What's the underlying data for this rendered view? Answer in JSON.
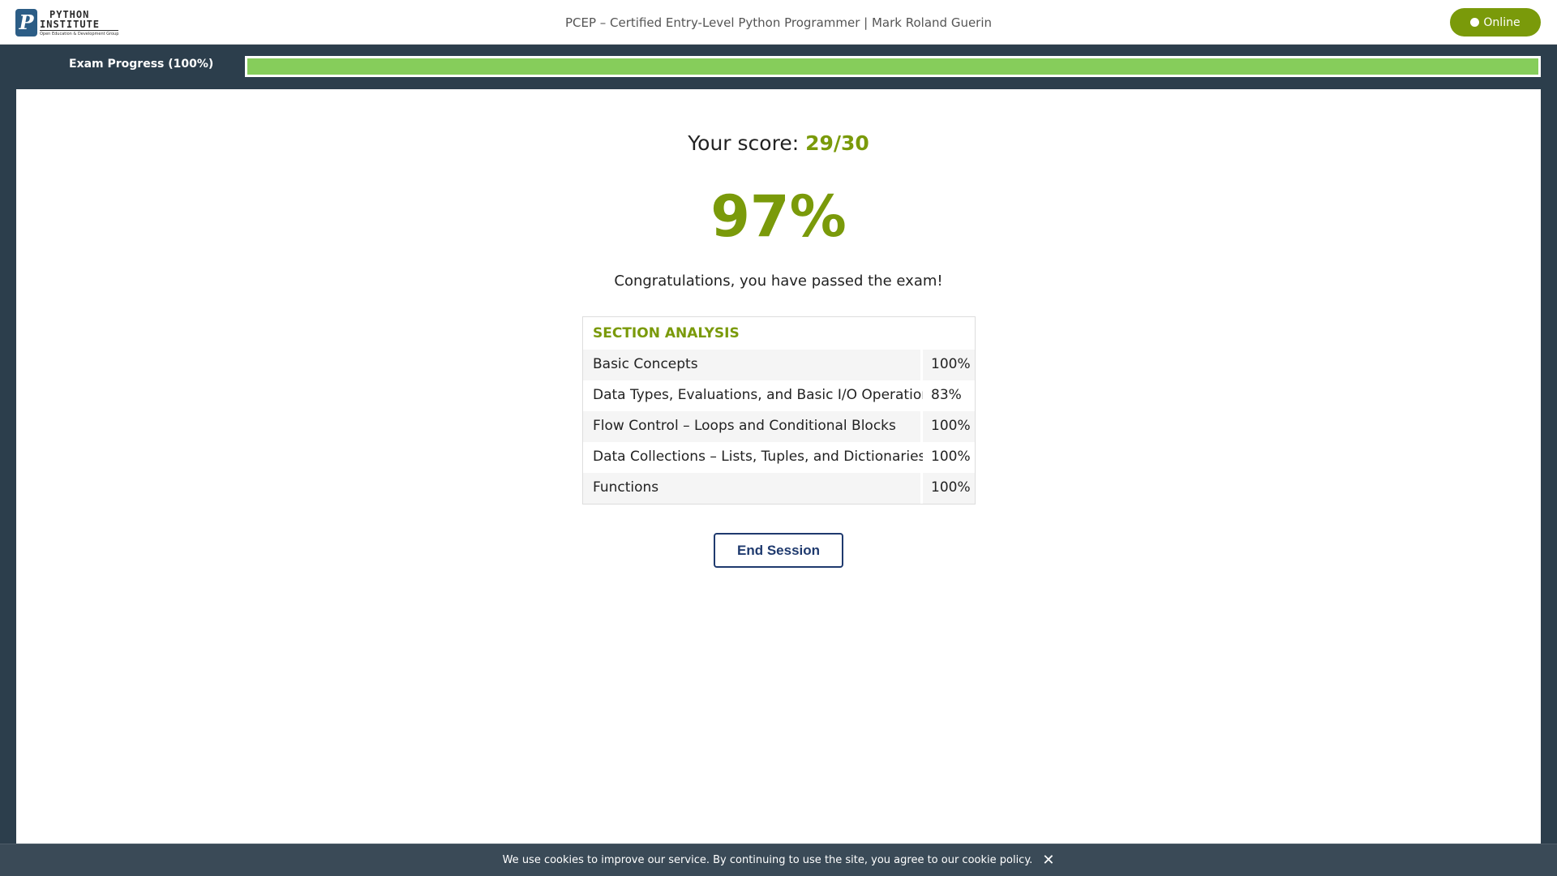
{
  "header": {
    "logo": {
      "line1": "PYTHON",
      "line2": "INSTITUTE",
      "tagline": "Open Education & Development Group"
    },
    "title": "PCEP – Certified Entry-Level Python Programmer | Mark Roland Guerin",
    "status_label": "Online"
  },
  "progress": {
    "label": "Exam Progress (100%)",
    "value_percent": 100
  },
  "result": {
    "score_prefix": "Your score:",
    "score_value": "29/30",
    "percent": "97%",
    "message": "Congratulations, you have passed the exam!"
  },
  "analysis": {
    "title": "SECTION ANALYSIS",
    "rows": [
      {
        "section": "Basic Concepts",
        "percent": "100%"
      },
      {
        "section": "Data Types, Evaluations, and Basic I/O Operations",
        "percent": "83%"
      },
      {
        "section": "Flow Control – Loops and Conditional Blocks",
        "percent": "100%"
      },
      {
        "section": "Data Collections – Lists, Tuples, and Dictionaries",
        "percent": "100%"
      },
      {
        "section": "Functions",
        "percent": "100%"
      }
    ]
  },
  "actions": {
    "end_session": "End Session"
  },
  "cookie": {
    "text": "We use cookies to improve our service. By continuing to use the site, you agree to our cookie policy.",
    "close_symbol": "✕"
  },
  "colors": {
    "accent_green": "#7a9a0a",
    "progress_green": "#86cd5b",
    "dark_bg": "#2c3e4c",
    "button_navy": "#1f3a6e"
  }
}
